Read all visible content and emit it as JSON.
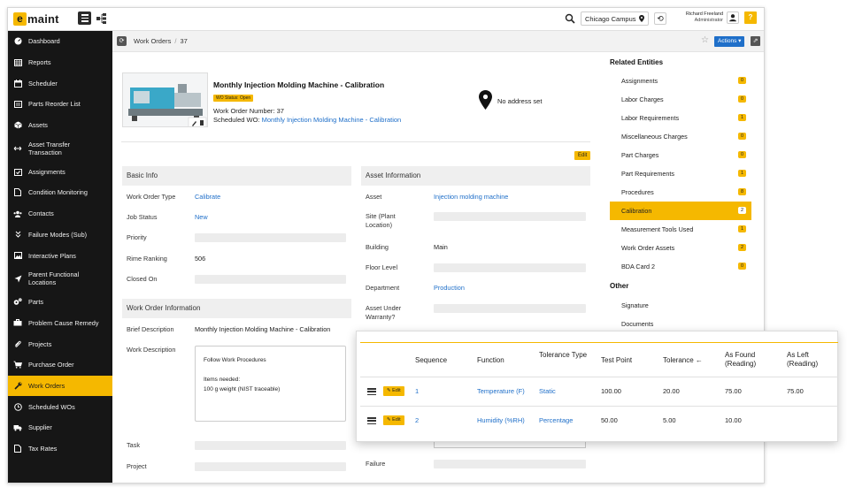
{
  "app": {
    "logo_letter": "e",
    "logo_text": "maint",
    "campus": "Chicago Campus",
    "user_name": "Richard Freeland",
    "user_role": "Administrator",
    "help_label": "?"
  },
  "sidebar": {
    "items": [
      {
        "label": "Dashboard",
        "icon": "dashboard-icon"
      },
      {
        "label": "Reports",
        "icon": "table-icon"
      },
      {
        "label": "Scheduler",
        "icon": "calendar-icon"
      },
      {
        "label": "Parts Reorder List",
        "icon": "list-icon"
      },
      {
        "label": "Assets",
        "icon": "cube-icon"
      },
      {
        "label": "Asset Transfer Transaction",
        "icon": "transfer-icon"
      },
      {
        "label": "Assignments",
        "icon": "calendar-check-icon"
      },
      {
        "label": "Condition Monitoring",
        "icon": "file-icon"
      },
      {
        "label": "Contacts",
        "icon": "users-icon"
      },
      {
        "label": "Failure Modes (Sub)",
        "icon": "chevrons-down-icon"
      },
      {
        "label": "Interactive Plans",
        "icon": "image-icon"
      },
      {
        "label": "Parent Functional Locations",
        "icon": "location-arrow-icon"
      },
      {
        "label": "Parts",
        "icon": "cogs-icon"
      },
      {
        "label": "Problem Cause Remedy",
        "icon": "briefcase-icon"
      },
      {
        "label": "Projects",
        "icon": "paperclip-icon"
      },
      {
        "label": "Purchase Order",
        "icon": "cart-icon"
      },
      {
        "label": "Work Orders",
        "icon": "wrench-icon"
      },
      {
        "label": "Scheduled WOs",
        "icon": "clock-icon"
      },
      {
        "label": "Supplier",
        "icon": "truck-icon"
      },
      {
        "label": "Tax Rates",
        "icon": "file-icon"
      }
    ],
    "active_index": 16
  },
  "breadcrumb": {
    "section": "Work Orders",
    "record": "37",
    "separator": "/",
    "actions_label": "Actions ▾"
  },
  "header": {
    "title": "Monthly Injection Molding Machine - Calibration",
    "status": "WO Status: Open",
    "wo_number_label": "Work Order Number:",
    "wo_number": "37",
    "scheduled_label": "Scheduled WO:",
    "scheduled_value": "Monthly Injection Molding Machine - Calibration",
    "address": "No address set",
    "edit_label": "Edit"
  },
  "basic_info": {
    "heading": "Basic Info",
    "fields": [
      {
        "label": "Work Order Type",
        "value": "Calibrate",
        "link": true
      },
      {
        "label": "Job Status",
        "value": "New",
        "link": true
      },
      {
        "label": "Priority",
        "value": ""
      },
      {
        "label": "Rime Ranking",
        "value": "506"
      },
      {
        "label": "Closed On",
        "value": ""
      }
    ]
  },
  "wo_info": {
    "heading": "Work Order Information",
    "brief_label": "Brief Description",
    "brief_value": "Monthly Injection Molding Machine - Calibration",
    "desc_label": "Work Description",
    "desc_lines": [
      "Follow Work Procedures",
      "",
      "Items needed:",
      "100 g weight (NIST traceable)"
    ],
    "task_label": "Task",
    "project_label": "Project"
  },
  "asset_info": {
    "heading": "Asset Information",
    "fields": [
      {
        "label": "Asset",
        "value": "Injection molding machine",
        "link": true
      },
      {
        "label": "Site (Plant Location)",
        "value": ""
      },
      {
        "label": "Building",
        "value": "Main"
      },
      {
        "label": "Floor Level",
        "value": ""
      },
      {
        "label": "Department",
        "value": "Production",
        "link": true
      },
      {
        "label": "Asset Under Warranty?",
        "value": ""
      }
    ],
    "failure_label": "Failure"
  },
  "related": {
    "heading": "Related Entities",
    "items": [
      {
        "label": "Assignments",
        "count": "0"
      },
      {
        "label": "Labor Charges",
        "count": "0"
      },
      {
        "label": "Labor Requirements",
        "count": "1"
      },
      {
        "label": "Miscellaneous Charges",
        "count": "0"
      },
      {
        "label": "Part Charges",
        "count": "0"
      },
      {
        "label": "Part Requirements",
        "count": "1"
      },
      {
        "label": "Procedures",
        "count": "8"
      },
      {
        "label": "Calibration",
        "count": "2"
      },
      {
        "label": "Measurement Tools Used",
        "count": "1"
      },
      {
        "label": "Work Order Assets",
        "count": "2"
      },
      {
        "label": "BDA Card 2",
        "count": "0"
      }
    ],
    "active_index": 7,
    "other_heading": "Other",
    "other_items": [
      "Signature",
      "Documents"
    ]
  },
  "calibration_table": {
    "columns": [
      "Sequence",
      "Function",
      "Tolerance Type",
      "Test Point",
      "Tolerance ←",
      "As Found (Reading)",
      "As Left (Reading)"
    ],
    "edit_label": "Edit",
    "rows": [
      {
        "sequence": "1",
        "function": "Temperature (F)",
        "tolerance_type": "Static",
        "test_point": "100.00",
        "tolerance": "20.00",
        "as_found": "75.00",
        "as_left": "75.00"
      },
      {
        "sequence": "2",
        "function": "Humidity (%RH)",
        "tolerance_type": "Percentage",
        "test_point": "50.00",
        "tolerance": "5.00",
        "as_found": "10.00",
        "as_left": ""
      }
    ]
  },
  "colors": {
    "accent": "#f5b800",
    "link": "#1f6fc9",
    "sidebar_bg": "#161616"
  }
}
